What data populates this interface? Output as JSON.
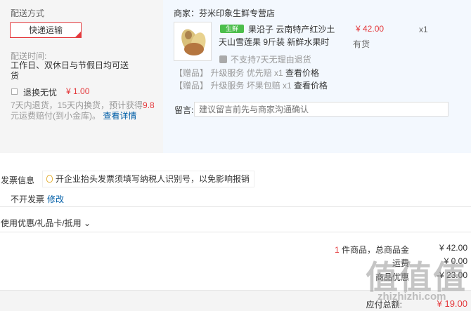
{
  "shipping": {
    "label": "配送方式",
    "method": "快递运输",
    "time_label": "配送时间:",
    "time_value": "工作日、双休日与节假日均可送货"
  },
  "swap_service": {
    "label": "退换无忧",
    "price": "¥ 1.00",
    "desc_a": "7天内退货，15天内换货，预计获得",
    "desc_highlight": "9.8",
    "desc_b": "元运费赔付(到小金库)。",
    "detail_link": "查看详情"
  },
  "seller": {
    "label": "商家：芬米印象生鲜专营店"
  },
  "product": {
    "badge": "生鲜",
    "title_line1": "果沿子 云南特产红沙土",
    "title_line2": "天山雪莲果 9斤装 新鲜水果时",
    "price": "¥ 42.00",
    "stock": "有货",
    "qty": "x1",
    "no_return": "不支持7天无理由退货",
    "gifts": [
      {
        "tag": "【赠品】",
        "text": "升级服务 优先赔 x1",
        "link": "查看价格"
      },
      {
        "tag": "【赠品】",
        "text": "升级服务 坏果包赔 x1",
        "link": "查看价格"
      }
    ]
  },
  "note": {
    "label": "留言:",
    "placeholder": "建议留言前先与商家沟通确认"
  },
  "invoice": {
    "label": "发票信息",
    "tip": "开企业抬头发票须填写纳税人识别号，以免影响报销",
    "status": "不开发票",
    "edit": "修改"
  },
  "discount": {
    "label": "使用优惠/礼品卡/抵用 ⌄"
  },
  "summary": {
    "items_count": "1",
    "items_label": " 件商品，总商品金",
    "items_value": "¥ 42.00",
    "line2_label": "运费",
    "line2_value": "¥ 0.00",
    "line3_label": "商品优惠",
    "line3_value": "-¥ 23.00",
    "total_label": "应付总额:",
    "total_value": "¥ 19.00"
  },
  "watermark": {
    "text": "值值值",
    "url": "zhizhizhi.com"
  },
  "colors": {
    "accent": "#e4393c",
    "link": "#005ea7",
    "fresh": "#4cbe4c"
  }
}
